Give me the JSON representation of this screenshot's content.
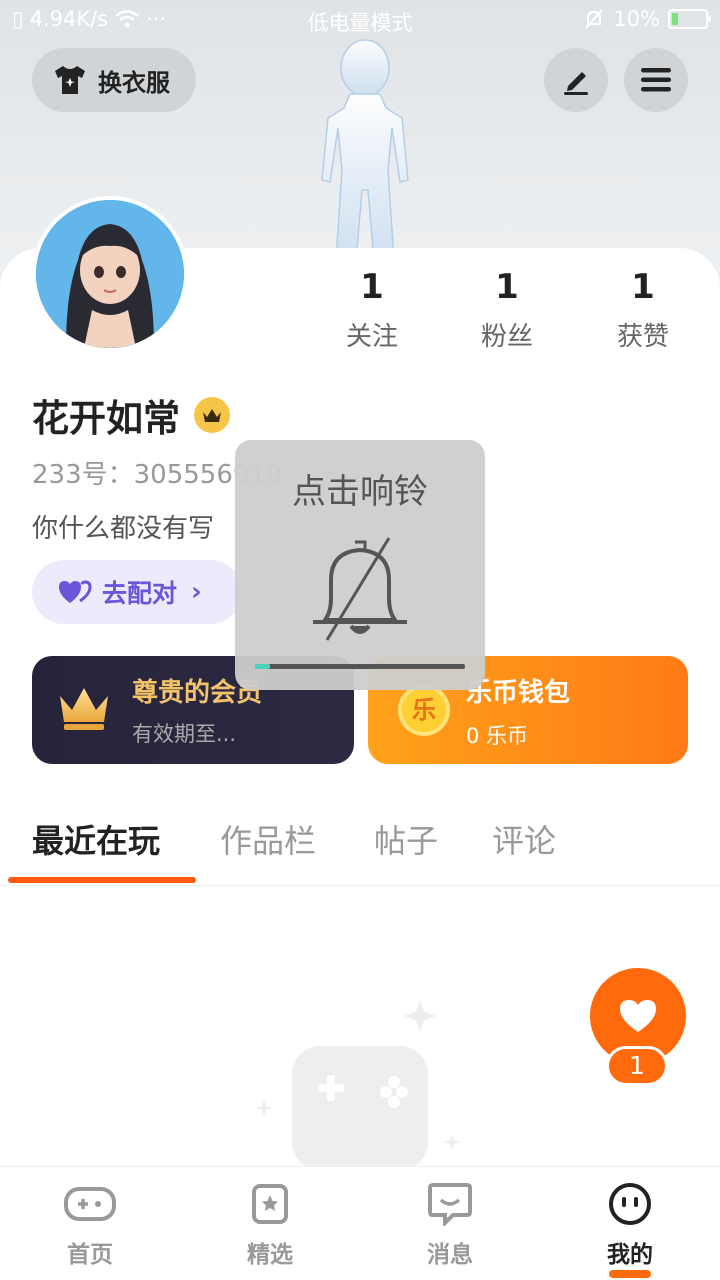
{
  "status_bar": {
    "net_speed": "4.94K/s",
    "more": "···",
    "mode": "低电量模式",
    "battery": "10%"
  },
  "header": {
    "outfit_label": "换衣服"
  },
  "profile": {
    "stats": [
      {
        "num": "1",
        "label": "关注"
      },
      {
        "num": "1",
        "label": "粉丝"
      },
      {
        "num": "1",
        "label": "获赞"
      }
    ],
    "nickname": "花开如常",
    "uid": "233号：305556919",
    "bio": "你什么都没有写",
    "match_label": "去配对"
  },
  "vip_card": {
    "title": "尊贵的会员",
    "subtitle": "有效期至..."
  },
  "wallet_card": {
    "title": "乐币钱包",
    "subtitle": "0 乐币",
    "coin_char": "乐"
  },
  "tabs": [
    "最近在玩",
    "作品栏",
    "帖子",
    "评论"
  ],
  "like": {
    "count": "1"
  },
  "bottom_nav": [
    {
      "label": "首页",
      "icon": "gamepad-icon"
    },
    {
      "label": "精选",
      "icon": "star-bookmark-icon"
    },
    {
      "label": "消息",
      "icon": "chat-icon"
    },
    {
      "label": "我的",
      "icon": "face-icon"
    }
  ],
  "toast": {
    "text": "点击响铃",
    "progress": 0.07
  },
  "colors": {
    "accent": "#ff6a0c",
    "vip_gold": "#f3c36a",
    "match_purple": "#6a56d8"
  }
}
